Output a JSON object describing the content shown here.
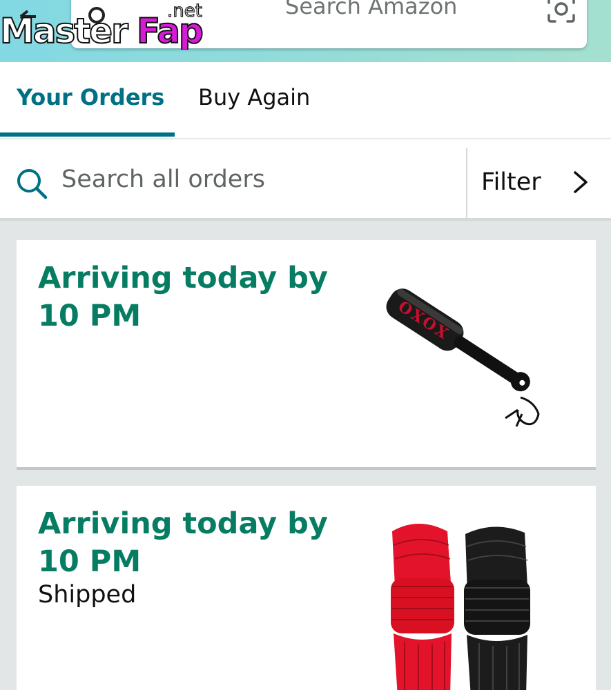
{
  "header": {
    "watermark": "MasterFap.net",
    "search_placeholder": "Search Amazon",
    "icons": [
      "back-arrow-icon",
      "search-icon",
      "camera-icon",
      "microphone-icon"
    ]
  },
  "tabs": [
    {
      "label": "Your Orders",
      "active": true
    },
    {
      "label": "Buy Again",
      "active": false
    }
  ],
  "order_search": {
    "placeholder": "Search all orders",
    "filter_label": "Filter"
  },
  "orders": [
    {
      "status": "Arriving today by 10 PM",
      "substatus": "",
      "product_image": "paddle-image"
    },
    {
      "status": "Arriving today by 10 PM",
      "substatus": "Shipped",
      "product_image": "rope-bundles-image"
    }
  ],
  "colors": {
    "accent_teal": "#007185",
    "status_green": "#067d62",
    "header_gradient_start": "#82d8e3",
    "header_gradient_end": "#a5e0cf"
  }
}
